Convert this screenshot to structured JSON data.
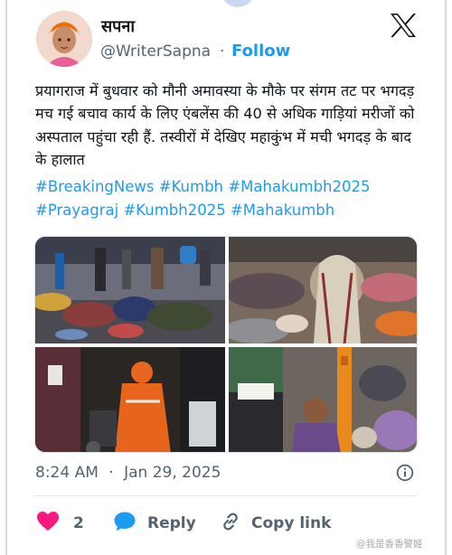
{
  "author": {
    "display_name": "सपना",
    "handle": "@WriterSapna",
    "separator": "·",
    "follow_label": "Follow"
  },
  "tweet": {
    "text": "प्रयागराज में बुधवार को मौनी अमावस्या के मौके पर संगम तट पर भगदड़ मच गई बचाव कार्य के लिए एंबलेंस की 40 से अधिक गाड़ियां मरीजों को अस्पताल पहुंचा रही हैं. तस्वीरों में देखिए महाकुंभ में मची भगदड़ के बाद के हालात",
    "hashtags": [
      "#BreakingNews",
      "#Kumbh",
      "#Mahakumbh2025",
      "#Prayagraj",
      "#Kumbh2025",
      "#Mahakumbh"
    ]
  },
  "meta": {
    "time": "8:24 AM",
    "separator": "·",
    "date": "Jan 29, 2025"
  },
  "actions": {
    "like_count": "2",
    "reply_label": "Reply",
    "copy_label": "Copy link"
  },
  "watermark": "@我是香香警姬",
  "icons": {
    "platform": "x-logo-icon",
    "like": "heart-icon",
    "reply": "speech-bubble-icon",
    "copy": "link-icon",
    "info": "info-icon"
  },
  "colors": {
    "link": "#1d9bf0",
    "like": "#f91880",
    "muted": "#536471"
  }
}
